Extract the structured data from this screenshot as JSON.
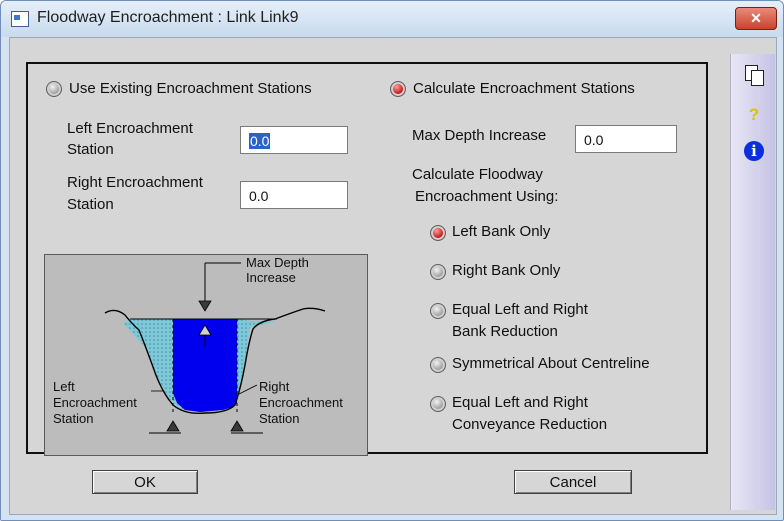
{
  "window": {
    "title": "Floodway Encroachment : Link Link9",
    "close_label": "✕"
  },
  "options": {
    "use_existing_label": "Use Existing Encroachment Stations",
    "calculate_label": "Calculate Encroachment Stations",
    "selected": "calculate"
  },
  "left_station": {
    "label_line1": "Left Encroachment",
    "label_line2": "Station",
    "value": "0.0"
  },
  "right_station": {
    "label_line1": "Right Encroachment",
    "label_line2": "Station",
    "value": "0.0"
  },
  "max_depth": {
    "label": "Max Depth Increase",
    "value": "0.0"
  },
  "method": {
    "heading_line1": "Calculate Floodway",
    "heading_line2": "Encroachment Using:",
    "selected": "left_bank_only",
    "options": [
      {
        "line1": "Left Bank Only",
        "line2": ""
      },
      {
        "line1": "Right Bank Only",
        "line2": ""
      },
      {
        "line1": "Equal Left and Right",
        "line2": "Bank Reduction"
      },
      {
        "line1": "Symmetrical About Centreline",
        "line2": ""
      },
      {
        "line1": "Equal Left and Right",
        "line2": "Conveyance Reduction"
      }
    ]
  },
  "diagram": {
    "max_depth_line1": "Max Depth",
    "max_depth_line2": "Increase",
    "left_line1": "Left",
    "left_line2": "Encroachment",
    "left_line3": "Station",
    "right_line1": "Right",
    "right_line2": "Encroachment",
    "right_line3": "Station",
    "water_color": "#0000ee"
  },
  "buttons": {
    "ok": "OK",
    "cancel": "Cancel"
  },
  "sidebar_icons": [
    "copy-icon",
    "help-icon",
    "info-icon"
  ],
  "icon_glyphs": {
    "help": "?",
    "info": "i"
  }
}
